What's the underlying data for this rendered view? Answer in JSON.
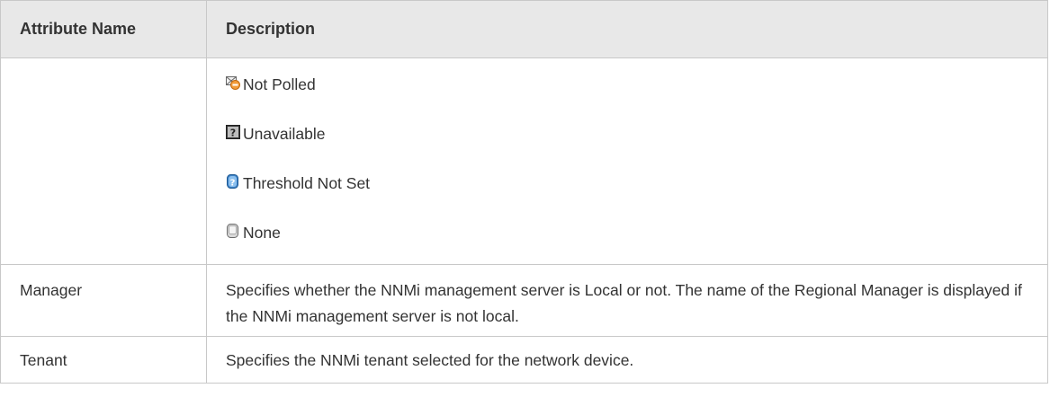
{
  "table": {
    "headers": {
      "attribute_name": "Attribute Name",
      "description": "Description"
    },
    "status_items": [
      {
        "icon": "not-polled-icon",
        "label": "Not Polled"
      },
      {
        "icon": "unavailable-icon",
        "label": "Unavailable"
      },
      {
        "icon": "threshold-not-set-icon",
        "label": "Threshold Not Set"
      },
      {
        "icon": "none-icon",
        "label": "None"
      }
    ],
    "rows": [
      {
        "name": "Manager",
        "description": "Specifies whether the NNMi management server is Local or not. The name of the Regional Manager is displayed if the NNMi management server is not local."
      },
      {
        "name": "Tenant",
        "description": "Specifies the NNMi tenant selected for the network device."
      }
    ]
  }
}
